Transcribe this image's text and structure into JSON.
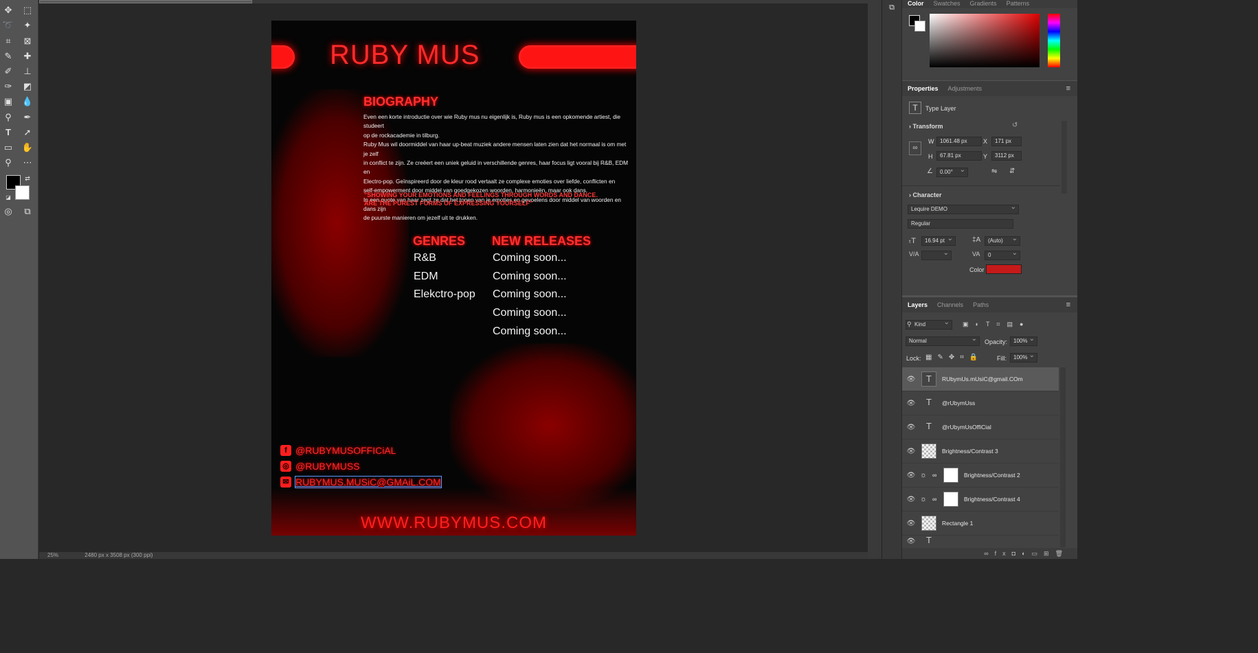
{
  "toolbar": {
    "tools": [
      "move-tool",
      "marquee-tool",
      "lasso-tool",
      "magic-wand-tool",
      "crop-tool",
      "frame-tool",
      "eyedropper-tool",
      "healing-tool",
      "brush-tool",
      "stamp-tool",
      "history-brush-tool",
      "eraser-tool",
      "gradient-tool",
      "blur-tool",
      "dodge-tool",
      "pen-tool",
      "type-tool",
      "path-select-tool",
      "rectangle-tool",
      "hand-tool",
      "zoom-tool",
      "more-tools"
    ],
    "foreground_color": "#000000",
    "background_color": "#ffffff"
  },
  "status": {
    "zoom": "25%",
    "doc_info": "2480 px x 3508 px (300 ppi)"
  },
  "document": {
    "title": "RUBY MUS",
    "bio_heading": "BIOGRAPHY",
    "bio_lines": [
      "Even een korte introductie over wie Ruby mus nu eigenlijk is, Ruby mus is een opkomende artiest, die studeert",
      "op de rockacademie in tilburg.",
      "Ruby Mus wil doormiddel van haar up-beat muziek andere mensen laten zien dat het normaal is om met je zelf",
      "in conflict te zijn. Ze creëert een uniek geluid in verschillende genres, haar focus ligt vooral bij R&B, EDM en",
      "Electro-pop. Geïnspireerd door de kleur rood vertaalt ze complexe emoties over liefde, conflicten en",
      "self-empowerment door middel van goedgekozen woorden, harmonieën, maar ook dans.",
      "In een quote van haar zegt ze dat het tonen van je emoties en gevoelens door middel van woorden en dans zijn",
      "de puurste manieren om jezelf uit te drukken."
    ],
    "quote_lines": [
      "\"SHOWING YOUR EMOTIONS AND FEELINGS THROUGH WORDS AND DANCE.",
      "ARE THE PUREST FORMS OF EXPRESSING YOURSELF\""
    ],
    "genres_heading": "GENRES",
    "genres": [
      "R&B",
      "EDM",
      "Elekctro-pop"
    ],
    "releases_heading": "NEW RELEASES",
    "releases": [
      "Coming soon...",
      "Coming soon...",
      "Coming soon...",
      "Coming soon...",
      "Coming soon..."
    ],
    "facebook": "@RUBYMUSOFFICiAL",
    "instagram": "@RUBYMUSS",
    "email": "RUBYMUS.MUSiC@GMAiL.COM",
    "website": "WWW.RUBYMUS.COM",
    "accent_color": "#ff1f1f"
  },
  "color_panel": {
    "tabs": [
      "Color",
      "Swatches",
      "Gradients",
      "Patterns"
    ]
  },
  "properties": {
    "tabs": [
      "Properties",
      "Adjustments"
    ],
    "layer_type": "Type Layer",
    "transform_heading": "Transform",
    "w_label": "W",
    "w_value": "1061.48 px",
    "h_label": "H",
    "h_value": "67.81 px",
    "x_label": "X",
    "x_value": "171 px",
    "y_label": "Y",
    "y_value": "3112 px",
    "angle_value": "0.00°",
    "character_heading": "Character",
    "font": "Lequire DEMO",
    "style": "Regular",
    "size": "16.94 pt",
    "leading": "(Auto)",
    "kerning": "",
    "tracking": "0",
    "color_label": "Color",
    "text_color": "#c61a1a"
  },
  "layers": {
    "tabs": [
      "Layers",
      "Channels",
      "Paths"
    ],
    "kind": "Kind",
    "blend_mode": "Normal",
    "opacity_label": "Opacity:",
    "opacity": "100%",
    "lock_label": "Lock:",
    "fill_label": "Fill:",
    "fill": "100%",
    "items": [
      {
        "name": "RUbymUs.mUsiC@gmail.COm",
        "kind": "text"
      },
      {
        "name": "@rUbymUss",
        "kind": "text"
      },
      {
        "name": "@rUbymUsOffiCial",
        "kind": "text"
      },
      {
        "name": "Brightness/Contrast 3",
        "kind": "checker"
      },
      {
        "name": "Brightness/Contrast 2",
        "kind": "adjust"
      },
      {
        "name": "Brightness/Contrast 4",
        "kind": "adjust"
      },
      {
        "name": "Rectangle 1",
        "kind": "shape"
      },
      {
        "name": "",
        "kind": "text"
      }
    ]
  }
}
